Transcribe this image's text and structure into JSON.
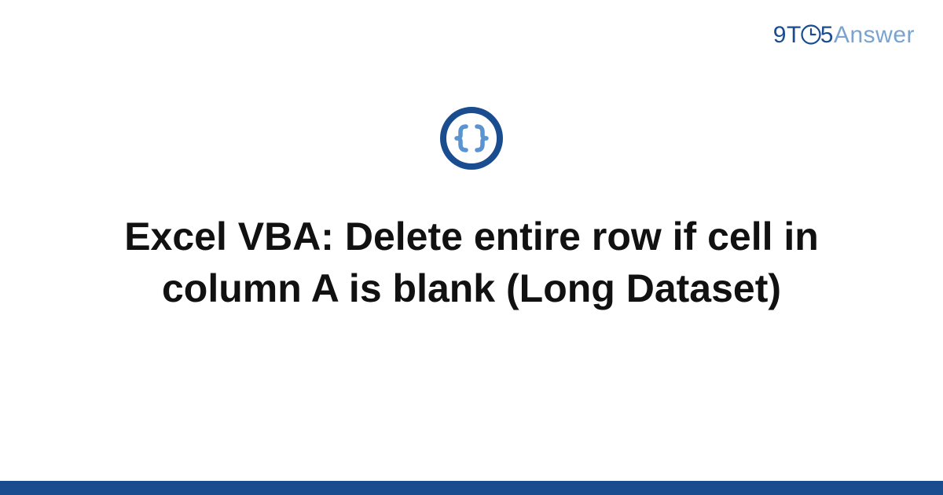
{
  "brand": {
    "nine": "9",
    "t": "T",
    "five": "5",
    "answer": "Answer"
  },
  "icon": {
    "name": "code-braces-icon",
    "ring_color": "#1a4d8f",
    "brace_color": "#5a93d0"
  },
  "title": "Excel VBA: Delete entire row if cell in column A is blank (Long Dataset)",
  "colors": {
    "brand_primary": "#1a4d8f",
    "brand_secondary": "#7aa3d0",
    "accent_bar": "#1a4d8f",
    "text": "#111111"
  }
}
